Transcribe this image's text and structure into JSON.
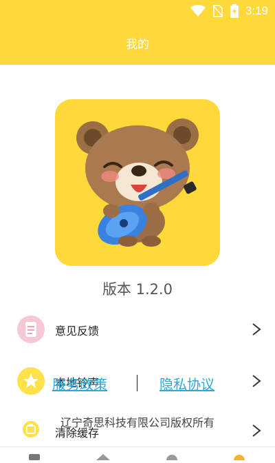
{
  "status_bar": {
    "time": "3:19"
  },
  "header": {
    "title": "我的"
  },
  "version_text": "版本 1.2.0",
  "menu": {
    "items": [
      {
        "label": "意见反馈",
        "icon": "feedback-icon",
        "color": "#f7c7d4"
      },
      {
        "label": "本地铃声",
        "icon": "star-icon",
        "color": "#ffe14a"
      },
      {
        "label": "清除缓存",
        "icon": "cache-icon",
        "color": "#ffe14a"
      }
    ]
  },
  "agreement": {
    "terms": "服务政策",
    "privacy": "隐私协议"
  },
  "footer": {
    "copyright": "辽宁奇思科技有限公司版权所有"
  },
  "colors": {
    "accent": "#ffd83a",
    "link": "#2ea8dc"
  }
}
